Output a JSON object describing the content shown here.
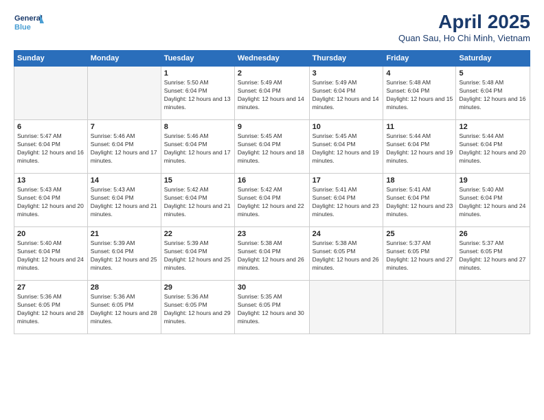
{
  "logo": {
    "line1": "General",
    "line2": "Blue"
  },
  "title": "April 2025",
  "subtitle": "Quan Sau, Ho Chi Minh, Vietnam",
  "days_of_week": [
    "Sunday",
    "Monday",
    "Tuesday",
    "Wednesday",
    "Thursday",
    "Friday",
    "Saturday"
  ],
  "weeks": [
    [
      {
        "num": "",
        "sunrise": "",
        "sunset": "",
        "daylight": "",
        "empty": true
      },
      {
        "num": "",
        "sunrise": "",
        "sunset": "",
        "daylight": "",
        "empty": true
      },
      {
        "num": "1",
        "sunrise": "Sunrise: 5:50 AM",
        "sunset": "Sunset: 6:04 PM",
        "daylight": "Daylight: 12 hours and 13 minutes."
      },
      {
        "num": "2",
        "sunrise": "Sunrise: 5:49 AM",
        "sunset": "Sunset: 6:04 PM",
        "daylight": "Daylight: 12 hours and 14 minutes."
      },
      {
        "num": "3",
        "sunrise": "Sunrise: 5:49 AM",
        "sunset": "Sunset: 6:04 PM",
        "daylight": "Daylight: 12 hours and 14 minutes."
      },
      {
        "num": "4",
        "sunrise": "Sunrise: 5:48 AM",
        "sunset": "Sunset: 6:04 PM",
        "daylight": "Daylight: 12 hours and 15 minutes."
      },
      {
        "num": "5",
        "sunrise": "Sunrise: 5:48 AM",
        "sunset": "Sunset: 6:04 PM",
        "daylight": "Daylight: 12 hours and 16 minutes."
      }
    ],
    [
      {
        "num": "6",
        "sunrise": "Sunrise: 5:47 AM",
        "sunset": "Sunset: 6:04 PM",
        "daylight": "Daylight: 12 hours and 16 minutes."
      },
      {
        "num": "7",
        "sunrise": "Sunrise: 5:46 AM",
        "sunset": "Sunset: 6:04 PM",
        "daylight": "Daylight: 12 hours and 17 minutes."
      },
      {
        "num": "8",
        "sunrise": "Sunrise: 5:46 AM",
        "sunset": "Sunset: 6:04 PM",
        "daylight": "Daylight: 12 hours and 17 minutes."
      },
      {
        "num": "9",
        "sunrise": "Sunrise: 5:45 AM",
        "sunset": "Sunset: 6:04 PM",
        "daylight": "Daylight: 12 hours and 18 minutes."
      },
      {
        "num": "10",
        "sunrise": "Sunrise: 5:45 AM",
        "sunset": "Sunset: 6:04 PM",
        "daylight": "Daylight: 12 hours and 19 minutes."
      },
      {
        "num": "11",
        "sunrise": "Sunrise: 5:44 AM",
        "sunset": "Sunset: 6:04 PM",
        "daylight": "Daylight: 12 hours and 19 minutes."
      },
      {
        "num": "12",
        "sunrise": "Sunrise: 5:44 AM",
        "sunset": "Sunset: 6:04 PM",
        "daylight": "Daylight: 12 hours and 20 minutes."
      }
    ],
    [
      {
        "num": "13",
        "sunrise": "Sunrise: 5:43 AM",
        "sunset": "Sunset: 6:04 PM",
        "daylight": "Daylight: 12 hours and 20 minutes."
      },
      {
        "num": "14",
        "sunrise": "Sunrise: 5:43 AM",
        "sunset": "Sunset: 6:04 PM",
        "daylight": "Daylight: 12 hours and 21 minutes."
      },
      {
        "num": "15",
        "sunrise": "Sunrise: 5:42 AM",
        "sunset": "Sunset: 6:04 PM",
        "daylight": "Daylight: 12 hours and 21 minutes."
      },
      {
        "num": "16",
        "sunrise": "Sunrise: 5:42 AM",
        "sunset": "Sunset: 6:04 PM",
        "daylight": "Daylight: 12 hours and 22 minutes."
      },
      {
        "num": "17",
        "sunrise": "Sunrise: 5:41 AM",
        "sunset": "Sunset: 6:04 PM",
        "daylight": "Daylight: 12 hours and 23 minutes."
      },
      {
        "num": "18",
        "sunrise": "Sunrise: 5:41 AM",
        "sunset": "Sunset: 6:04 PM",
        "daylight": "Daylight: 12 hours and 23 minutes."
      },
      {
        "num": "19",
        "sunrise": "Sunrise: 5:40 AM",
        "sunset": "Sunset: 6:04 PM",
        "daylight": "Daylight: 12 hours and 24 minutes."
      }
    ],
    [
      {
        "num": "20",
        "sunrise": "Sunrise: 5:40 AM",
        "sunset": "Sunset: 6:04 PM",
        "daylight": "Daylight: 12 hours and 24 minutes."
      },
      {
        "num": "21",
        "sunrise": "Sunrise: 5:39 AM",
        "sunset": "Sunset: 6:04 PM",
        "daylight": "Daylight: 12 hours and 25 minutes."
      },
      {
        "num": "22",
        "sunrise": "Sunrise: 5:39 AM",
        "sunset": "Sunset: 6:04 PM",
        "daylight": "Daylight: 12 hours and 25 minutes."
      },
      {
        "num": "23",
        "sunrise": "Sunrise: 5:38 AM",
        "sunset": "Sunset: 6:04 PM",
        "daylight": "Daylight: 12 hours and 26 minutes."
      },
      {
        "num": "24",
        "sunrise": "Sunrise: 5:38 AM",
        "sunset": "Sunset: 6:05 PM",
        "daylight": "Daylight: 12 hours and 26 minutes."
      },
      {
        "num": "25",
        "sunrise": "Sunrise: 5:37 AM",
        "sunset": "Sunset: 6:05 PM",
        "daylight": "Daylight: 12 hours and 27 minutes."
      },
      {
        "num": "26",
        "sunrise": "Sunrise: 5:37 AM",
        "sunset": "Sunset: 6:05 PM",
        "daylight": "Daylight: 12 hours and 27 minutes."
      }
    ],
    [
      {
        "num": "27",
        "sunrise": "Sunrise: 5:36 AM",
        "sunset": "Sunset: 6:05 PM",
        "daylight": "Daylight: 12 hours and 28 minutes."
      },
      {
        "num": "28",
        "sunrise": "Sunrise: 5:36 AM",
        "sunset": "Sunset: 6:05 PM",
        "daylight": "Daylight: 12 hours and 28 minutes."
      },
      {
        "num": "29",
        "sunrise": "Sunrise: 5:36 AM",
        "sunset": "Sunset: 6:05 PM",
        "daylight": "Daylight: 12 hours and 29 minutes."
      },
      {
        "num": "30",
        "sunrise": "Sunrise: 5:35 AM",
        "sunset": "Sunset: 6:05 PM",
        "daylight": "Daylight: 12 hours and 30 minutes."
      },
      {
        "num": "",
        "sunrise": "",
        "sunset": "",
        "daylight": "",
        "empty": true
      },
      {
        "num": "",
        "sunrise": "",
        "sunset": "",
        "daylight": "",
        "empty": true
      },
      {
        "num": "",
        "sunrise": "",
        "sunset": "",
        "daylight": "",
        "empty": true
      }
    ]
  ]
}
